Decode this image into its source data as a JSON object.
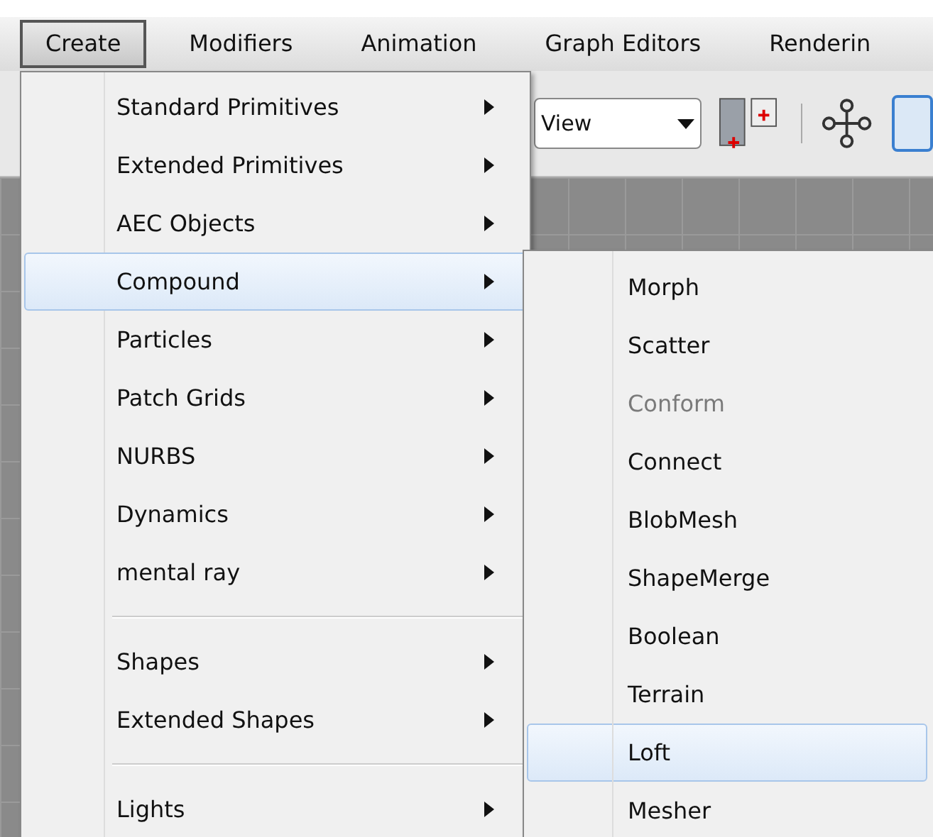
{
  "menubar": [
    {
      "label": "Create",
      "selected": true
    },
    {
      "label": "Modifiers",
      "selected": false
    },
    {
      "label": "Animation",
      "selected": false
    },
    {
      "label": "Graph Editors",
      "selected": false
    },
    {
      "label": "Renderin",
      "selected": false
    }
  ],
  "toolbar": {
    "view_dropdown": "View"
  },
  "create_menu": [
    {
      "kind": "item",
      "label": "Standard Primitives",
      "selected": false
    },
    {
      "kind": "item",
      "label": "Extended Primitives",
      "selected": false
    },
    {
      "kind": "item",
      "label": "AEC Objects",
      "selected": false
    },
    {
      "kind": "item",
      "label": "Compound",
      "selected": true
    },
    {
      "kind": "item",
      "label": "Particles",
      "selected": false
    },
    {
      "kind": "item",
      "label": "Patch Grids",
      "selected": false
    },
    {
      "kind": "item",
      "label": "NURBS",
      "selected": false
    },
    {
      "kind": "item",
      "label": "Dynamics",
      "selected": false
    },
    {
      "kind": "item",
      "label": "mental ray",
      "selected": false
    },
    {
      "kind": "separator"
    },
    {
      "kind": "item",
      "label": "Shapes",
      "selected": false
    },
    {
      "kind": "item",
      "label": "Extended Shapes",
      "selected": false
    },
    {
      "kind": "separator"
    },
    {
      "kind": "item",
      "label": "Lights",
      "selected": false
    }
  ],
  "compound_submenu": [
    {
      "label": "Morph",
      "selected": false,
      "disabled": false
    },
    {
      "label": "Scatter",
      "selected": false,
      "disabled": false
    },
    {
      "label": "Conform",
      "selected": false,
      "disabled": true
    },
    {
      "label": "Connect",
      "selected": false,
      "disabled": false
    },
    {
      "label": "BlobMesh",
      "selected": false,
      "disabled": false
    },
    {
      "label": "ShapeMerge",
      "selected": false,
      "disabled": false
    },
    {
      "label": "Boolean",
      "selected": false,
      "disabled": false
    },
    {
      "label": "Terrain",
      "selected": false,
      "disabled": false
    },
    {
      "label": "Loft",
      "selected": true,
      "disabled": false
    },
    {
      "label": "Mesher",
      "selected": false,
      "disabled": false
    }
  ]
}
